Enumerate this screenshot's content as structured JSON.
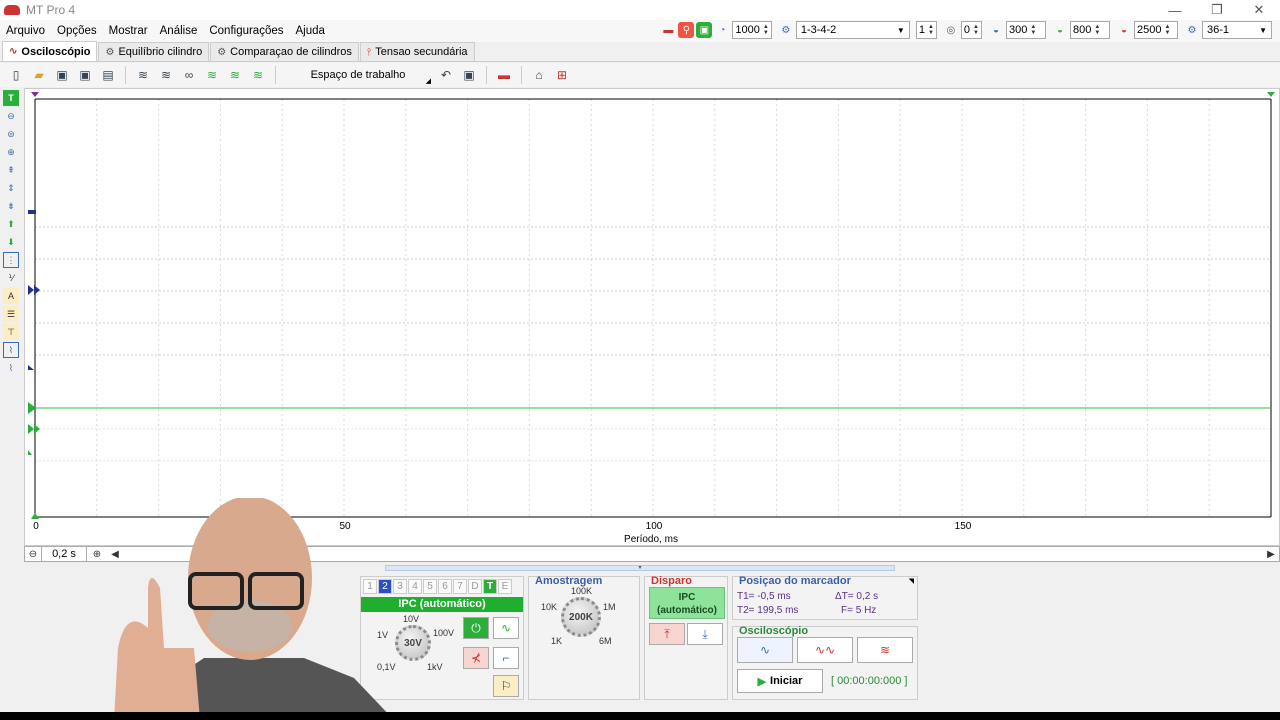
{
  "window": {
    "title": "MT Pro 4",
    "minimize": "—",
    "restore": "❐",
    "close": "✕"
  },
  "menu": [
    {
      "label": "Arquivo"
    },
    {
      "label": "Opções"
    },
    {
      "label": "Mostrar"
    },
    {
      "label": "Análise"
    },
    {
      "label": "Configurações"
    },
    {
      "label": "Ajuda"
    }
  ],
  "status": {
    "rpm": "1000",
    "firing_order": "1-3-4-2",
    "cylinder": "1",
    "offset": "0",
    "val_300": "300",
    "val_800": "800",
    "val_2500": "2500",
    "sensor": "36-1"
  },
  "tabs": [
    {
      "label": "Osciloscópio",
      "active": true
    },
    {
      "label": "Equilíbrio cilindro",
      "active": false
    },
    {
      "label": "Comparaçao de cilindros",
      "active": false
    },
    {
      "label": "Tensao secundária",
      "active": false
    }
  ],
  "toolbar": {
    "workspace_label": "Espaço de trabalho"
  },
  "plot": {
    "x_ticks": [
      "0",
      "50",
      "100",
      "150"
    ],
    "x_label": "Período, ms"
  },
  "scroll": {
    "zoom_value": "0,2 s"
  },
  "channels": {
    "tabs": [
      "1",
      "2",
      "3",
      "4",
      "5",
      "6",
      "7",
      "D",
      "T",
      "E"
    ],
    "selected": "2",
    "mode_label": "IPC (automático)",
    "knob_value": "30V",
    "knob_labels": {
      "top": "10V",
      "left": "1V",
      "right": "100V",
      "bottom_left": "0,1V",
      "bottom_right": "1kV"
    }
  },
  "sampling": {
    "title": "Amostragem",
    "knob_value": "200K",
    "labels": {
      "top": "100K",
      "left": "10K",
      "right": "1M",
      "bottom_left": "1K",
      "bottom_right": "6M"
    }
  },
  "trigger": {
    "title": "Disparo",
    "mode_line1": "IPC",
    "mode_line2": "(automático)"
  },
  "marker": {
    "title": "Posiçao do marcador",
    "t1": "T1= -0,5 ms",
    "t2": "T2= 199,5 ms",
    "dt": "ΔT= 0,2 s",
    "freq": "F= 5 Hz"
  },
  "scope": {
    "title": "Osciloscópio",
    "start_label": "Iniciar",
    "timer": "[ 00:00:00:000 ]"
  },
  "colors": {
    "accent_green": "#1fae2d",
    "accent_blue": "#2c4fc9",
    "grid": "#c8c8e8"
  }
}
